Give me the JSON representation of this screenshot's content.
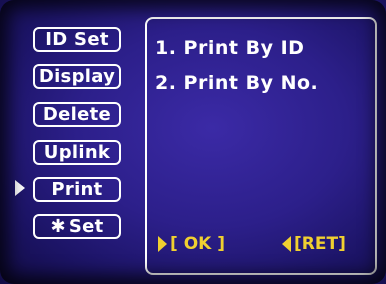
{
  "menu": {
    "items": [
      {
        "label": "ID Set"
      },
      {
        "label": "Display"
      },
      {
        "label": "Delete"
      },
      {
        "label": "Uplink"
      },
      {
        "label": "Print"
      },
      {
        "label": "Set",
        "icon": "bluetooth-icon"
      }
    ],
    "selected_index": 4,
    "bluetooth_glyph": "✱"
  },
  "panel": {
    "options": [
      "1. Print By ID",
      "2. Print By No."
    ]
  },
  "softkeys": {
    "ok_label": "[ OK ]",
    "ret_label": "[RET]"
  },
  "colors": {
    "background": "#2c1f8a",
    "text": "#ffffff",
    "softkey": "#f0d030"
  }
}
